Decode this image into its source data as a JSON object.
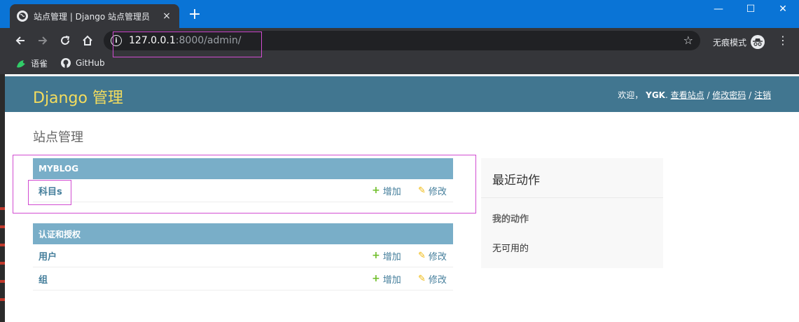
{
  "browser": {
    "tab_title": "站点管理 | Django 站点管理员",
    "tab_close": "×",
    "new_tab": "+",
    "window_controls": [
      "—",
      "☐",
      "✕"
    ],
    "url_host": "127.0.0.1",
    "url_rest": ":8000/admin/",
    "incognito_label": "无痕模式",
    "bookmarks": [
      {
        "label": "语雀",
        "icon": "yuque-icon"
      },
      {
        "label": "GitHub",
        "icon": "github-icon"
      }
    ]
  },
  "admin": {
    "branding": "Django 管理",
    "user_tools": {
      "welcome": "欢迎，",
      "username": "YGK",
      "sep_after_user": ". ",
      "view_site": "查看站点",
      "sep": " / ",
      "change_password": "修改密码",
      "logout": "注销"
    },
    "page_title": "站点管理",
    "apps": [
      {
        "caption": "MYBLOG",
        "models": [
          {
            "name": "科目s",
            "add": "增加",
            "change": "修改"
          }
        ]
      },
      {
        "caption": "认证和授权",
        "models": [
          {
            "name": "用户",
            "add": "增加",
            "change": "修改"
          },
          {
            "name": "组",
            "add": "增加",
            "change": "修改"
          }
        ]
      }
    ],
    "recent_actions": {
      "title": "最近动作",
      "subtitle": "我的动作",
      "empty": "无可用的"
    }
  },
  "colors": {
    "header_bg": "#417690",
    "branding": "#f5dd5d",
    "caption_bg": "#79aec8",
    "link": "#447e9b",
    "annotation": "#d14cd1"
  }
}
